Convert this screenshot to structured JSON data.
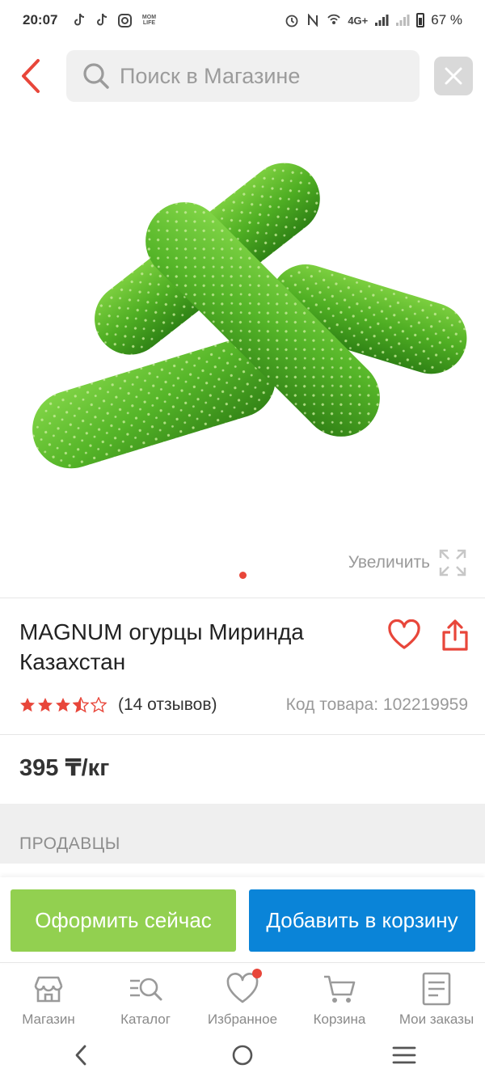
{
  "status_bar": {
    "time": "20:07",
    "left_icons": [
      "tiktok-icon",
      "tiktok-icon",
      "instagram-icon",
      "momlife-icon"
    ],
    "momlife_text": "MOM LIFE",
    "right_icons": [
      "alarm-icon",
      "nfc-icon",
      "hotspot-icon",
      "signal-4g-icon",
      "signal-icon",
      "battery-icon"
    ],
    "network": "4G+",
    "battery": "67 %"
  },
  "search": {
    "placeholder": "Поиск в Магазине"
  },
  "gallery": {
    "zoom_label": "Увеличить",
    "current_slide": 1,
    "slides_count": 1
  },
  "product": {
    "title": "MAGNUM огурцы Миринда Казахстан",
    "rating": 3.5,
    "rating_max": 5,
    "reviews": "(14 отзывов)",
    "code": "Код товара: 102219959",
    "price": "395 ₸/кг"
  },
  "sellers": {
    "label": "ПРОДАВЦЫ"
  },
  "actions": {
    "buy_now": "Оформить сейчас",
    "add_to_cart": "Добавить в корзину"
  },
  "tabs": [
    {
      "label": "Магазин",
      "icon": "shop-icon"
    },
    {
      "label": "Каталог",
      "icon": "catalog-search-icon"
    },
    {
      "label": "Избранное",
      "icon": "heart-icon",
      "badge": true
    },
    {
      "label": "Корзина",
      "icon": "cart-icon"
    },
    {
      "label": "Мои заказы",
      "icon": "orders-icon"
    }
  ],
  "colors": {
    "accent_red": "#e8463a",
    "buy_now_green": "#92d050",
    "add_cart_blue": "#0a84d8"
  }
}
